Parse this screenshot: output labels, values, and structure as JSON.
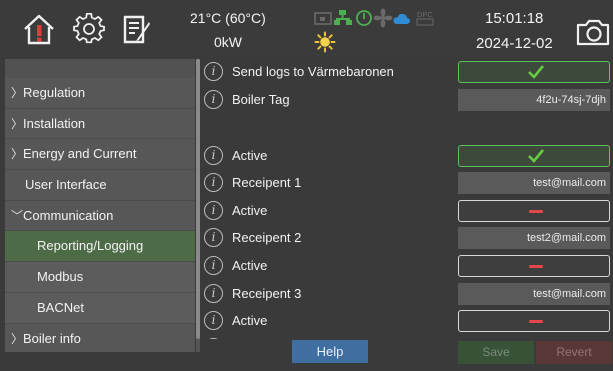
{
  "header": {
    "temperature": "21°C (60°C)",
    "power": "0kW",
    "status_text": "DPC",
    "time": "15:01:18",
    "date": "2024-12-02",
    "icons": [
      "home-alert-icon",
      "gear-icon",
      "notepad-icon",
      "sun-icon",
      "camera-icon"
    ]
  },
  "sidebar": {
    "items": [
      {
        "label": "Regulation",
        "arrow": ">"
      },
      {
        "label": "Installation",
        "arrow": ">"
      },
      {
        "label": "Energy and Current",
        "arrow": ">"
      },
      {
        "label": "User Interface",
        "arrow": ""
      },
      {
        "label": "Communication",
        "arrow": "v"
      },
      {
        "label": "Reporting/Logging",
        "arrow": "",
        "active": true
      },
      {
        "label": "Modbus",
        "arrow": ""
      },
      {
        "label": "BACNet",
        "arrow": ""
      },
      {
        "label": "Boiler info",
        "arrow": ">"
      }
    ]
  },
  "settings": {
    "send_logs_label": "Send logs to Värmebaronen",
    "send_logs_state": "on",
    "boiler_tag_label": "Boiler Tag",
    "boiler_tag_value": "4f2u-74sj-7djh",
    "active1_label": "Active",
    "active1_state": "on",
    "recipient1_label": "Receipent 1",
    "recipient1_value": "test@mail.com",
    "active2_label": "Active",
    "active2_state": "off",
    "recipient2_label": "Receipent 2",
    "recipient2_value": "test2@mail.com",
    "active3_label": "Active",
    "active3_state": "off",
    "recipient3_label": "Receipent 3",
    "recipient3_value": "test@mail.com",
    "active4_label": "Active",
    "active4_state": "off",
    "info_glyph": "i"
  },
  "footer": {
    "help_label": "Help",
    "save_label": "Save",
    "revert_label": "Revert"
  },
  "colors": {
    "background": "#3a3a3a",
    "active_nav": "#4e6b47",
    "toggle_on": "#5cc05e",
    "toggle_off_mark": "#e24646",
    "help_button": "#3f6ea0"
  }
}
